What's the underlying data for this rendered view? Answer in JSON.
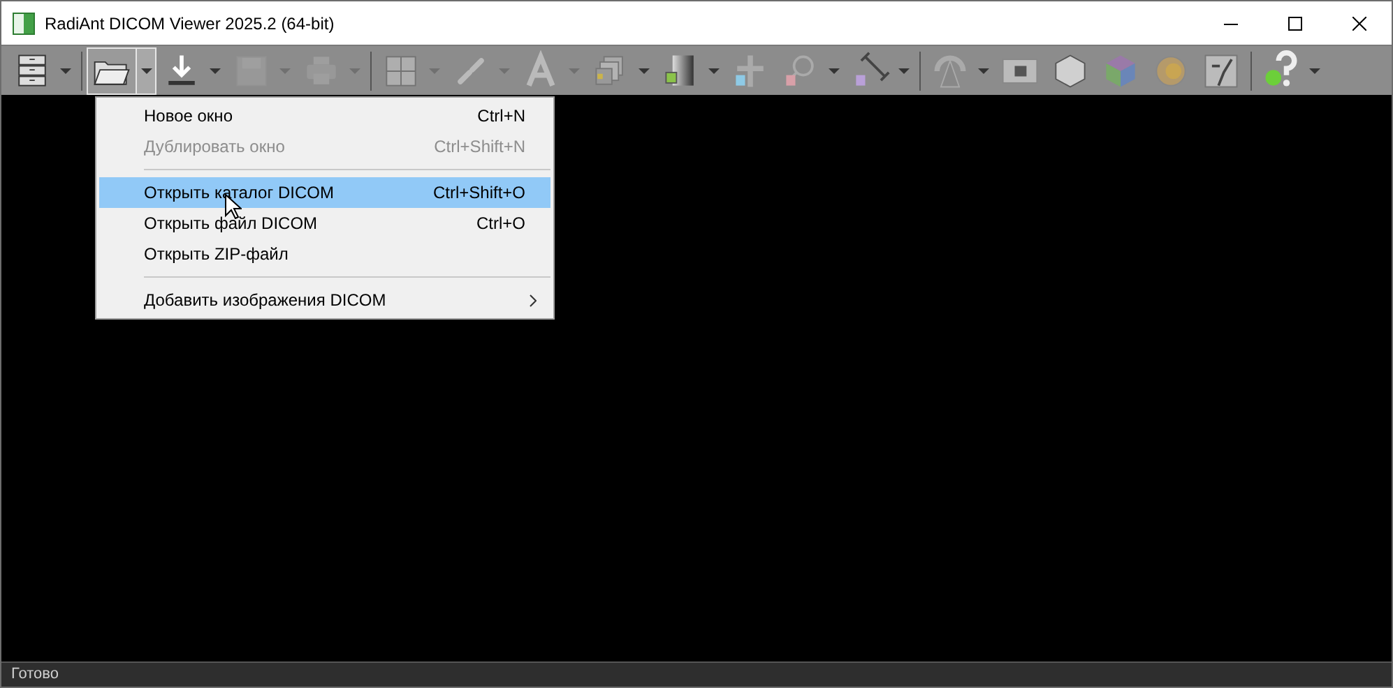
{
  "window": {
    "title": "RadiAnt DICOM Viewer 2025.2 (64-bit)"
  },
  "toolbar": [
    [
      {
        "kind": "studies",
        "dropdown": true,
        "disabled": false,
        "pressed": false
      }
    ],
    [
      {
        "kind": "open",
        "dropdown": true,
        "disabled": false,
        "pressed": true
      },
      {
        "kind": "import",
        "dropdown": true,
        "disabled": false,
        "pressed": false
      },
      {
        "kind": "save",
        "dropdown": true,
        "disabled": true,
        "pressed": false
      },
      {
        "kind": "print",
        "dropdown": true,
        "disabled": true,
        "pressed": false
      }
    ],
    [
      {
        "kind": "layout",
        "dropdown": true,
        "disabled": true,
        "pressed": false
      },
      {
        "kind": "link",
        "dropdown": true,
        "disabled": true,
        "pressed": false
      },
      {
        "kind": "text",
        "dropdown": true,
        "disabled": true,
        "pressed": false
      },
      {
        "kind": "series",
        "dropdown": true,
        "disabled": false,
        "pressed": false
      },
      {
        "kind": "contrast",
        "dropdown": true,
        "disabled": false,
        "pressed": false
      },
      {
        "kind": "pan",
        "dropdown": false,
        "disabled": false,
        "pressed": false
      },
      {
        "kind": "zoom",
        "dropdown": true,
        "disabled": false,
        "pressed": false
      },
      {
        "kind": "ruler",
        "dropdown": true,
        "disabled": false,
        "pressed": false
      }
    ],
    [
      {
        "kind": "angle",
        "dropdown": true,
        "disabled": false,
        "pressed": false
      },
      {
        "kind": "film",
        "dropdown": false,
        "disabled": false,
        "pressed": false
      },
      {
        "kind": "mpr",
        "dropdown": false,
        "disabled": false,
        "pressed": false
      },
      {
        "kind": "cube",
        "dropdown": false,
        "disabled": false,
        "pressed": false
      },
      {
        "kind": "fusion",
        "dropdown": false,
        "disabled": false,
        "pressed": false
      },
      {
        "kind": "curve",
        "dropdown": false,
        "disabled": false,
        "pressed": false
      }
    ],
    [
      {
        "kind": "help",
        "dropdown": true,
        "disabled": false,
        "pressed": false
      }
    ]
  ],
  "menu": [
    {
      "kind": "item",
      "label": "Новое окно",
      "shortcut": "Ctrl+N",
      "disabled": false,
      "selected": false
    },
    {
      "kind": "item",
      "label": "Дублировать окно",
      "shortcut": "Ctrl+Shift+N",
      "disabled": true,
      "selected": false
    },
    {
      "kind": "separator"
    },
    {
      "kind": "item",
      "label": "Открыть каталог DICOM",
      "shortcut": "Ctrl+Shift+O",
      "disabled": false,
      "selected": true
    },
    {
      "kind": "item",
      "label": "Открыть файл DICOM",
      "shortcut": "Ctrl+O",
      "disabled": false,
      "selected": false
    },
    {
      "kind": "item",
      "label": "Открыть ZIP-файл",
      "disabled": false,
      "selected": false
    },
    {
      "kind": "separator"
    },
    {
      "kind": "submenu",
      "label": "Добавить изображения DICOM",
      "disabled": false,
      "selected": false
    }
  ],
  "status_bar": {
    "text": "Готово"
  }
}
